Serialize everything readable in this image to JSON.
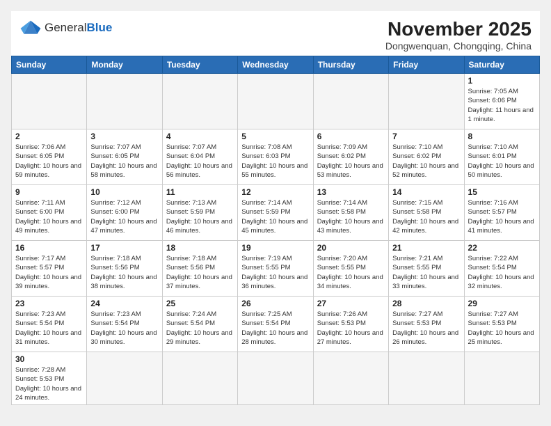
{
  "header": {
    "logo_general": "General",
    "logo_blue": "Blue",
    "month_title": "November 2025",
    "location": "Dongwenquan, Chongqing, China"
  },
  "weekdays": [
    "Sunday",
    "Monday",
    "Tuesday",
    "Wednesday",
    "Thursday",
    "Friday",
    "Saturday"
  ],
  "days": [
    {
      "num": "",
      "info": ""
    },
    {
      "num": "",
      "info": ""
    },
    {
      "num": "",
      "info": ""
    },
    {
      "num": "",
      "info": ""
    },
    {
      "num": "",
      "info": ""
    },
    {
      "num": "",
      "info": ""
    },
    {
      "num": "1",
      "info": "Sunrise: 7:05 AM\nSunset: 6:06 PM\nDaylight: 11 hours and 1 minute."
    },
    {
      "num": "2",
      "info": "Sunrise: 7:06 AM\nSunset: 6:05 PM\nDaylight: 10 hours and 59 minutes."
    },
    {
      "num": "3",
      "info": "Sunrise: 7:07 AM\nSunset: 6:05 PM\nDaylight: 10 hours and 58 minutes."
    },
    {
      "num": "4",
      "info": "Sunrise: 7:07 AM\nSunset: 6:04 PM\nDaylight: 10 hours and 56 minutes."
    },
    {
      "num": "5",
      "info": "Sunrise: 7:08 AM\nSunset: 6:03 PM\nDaylight: 10 hours and 55 minutes."
    },
    {
      "num": "6",
      "info": "Sunrise: 7:09 AM\nSunset: 6:02 PM\nDaylight: 10 hours and 53 minutes."
    },
    {
      "num": "7",
      "info": "Sunrise: 7:10 AM\nSunset: 6:02 PM\nDaylight: 10 hours and 52 minutes."
    },
    {
      "num": "8",
      "info": "Sunrise: 7:10 AM\nSunset: 6:01 PM\nDaylight: 10 hours and 50 minutes."
    },
    {
      "num": "9",
      "info": "Sunrise: 7:11 AM\nSunset: 6:00 PM\nDaylight: 10 hours and 49 minutes."
    },
    {
      "num": "10",
      "info": "Sunrise: 7:12 AM\nSunset: 6:00 PM\nDaylight: 10 hours and 47 minutes."
    },
    {
      "num": "11",
      "info": "Sunrise: 7:13 AM\nSunset: 5:59 PM\nDaylight: 10 hours and 46 minutes."
    },
    {
      "num": "12",
      "info": "Sunrise: 7:14 AM\nSunset: 5:59 PM\nDaylight: 10 hours and 45 minutes."
    },
    {
      "num": "13",
      "info": "Sunrise: 7:14 AM\nSunset: 5:58 PM\nDaylight: 10 hours and 43 minutes."
    },
    {
      "num": "14",
      "info": "Sunrise: 7:15 AM\nSunset: 5:58 PM\nDaylight: 10 hours and 42 minutes."
    },
    {
      "num": "15",
      "info": "Sunrise: 7:16 AM\nSunset: 5:57 PM\nDaylight: 10 hours and 41 minutes."
    },
    {
      "num": "16",
      "info": "Sunrise: 7:17 AM\nSunset: 5:57 PM\nDaylight: 10 hours and 39 minutes."
    },
    {
      "num": "17",
      "info": "Sunrise: 7:18 AM\nSunset: 5:56 PM\nDaylight: 10 hours and 38 minutes."
    },
    {
      "num": "18",
      "info": "Sunrise: 7:18 AM\nSunset: 5:56 PM\nDaylight: 10 hours and 37 minutes."
    },
    {
      "num": "19",
      "info": "Sunrise: 7:19 AM\nSunset: 5:55 PM\nDaylight: 10 hours and 36 minutes."
    },
    {
      "num": "20",
      "info": "Sunrise: 7:20 AM\nSunset: 5:55 PM\nDaylight: 10 hours and 34 minutes."
    },
    {
      "num": "21",
      "info": "Sunrise: 7:21 AM\nSunset: 5:55 PM\nDaylight: 10 hours and 33 minutes."
    },
    {
      "num": "22",
      "info": "Sunrise: 7:22 AM\nSunset: 5:54 PM\nDaylight: 10 hours and 32 minutes."
    },
    {
      "num": "23",
      "info": "Sunrise: 7:23 AM\nSunset: 5:54 PM\nDaylight: 10 hours and 31 minutes."
    },
    {
      "num": "24",
      "info": "Sunrise: 7:23 AM\nSunset: 5:54 PM\nDaylight: 10 hours and 30 minutes."
    },
    {
      "num": "25",
      "info": "Sunrise: 7:24 AM\nSunset: 5:54 PM\nDaylight: 10 hours and 29 minutes."
    },
    {
      "num": "26",
      "info": "Sunrise: 7:25 AM\nSunset: 5:54 PM\nDaylight: 10 hours and 28 minutes."
    },
    {
      "num": "27",
      "info": "Sunrise: 7:26 AM\nSunset: 5:53 PM\nDaylight: 10 hours and 27 minutes."
    },
    {
      "num": "28",
      "info": "Sunrise: 7:27 AM\nSunset: 5:53 PM\nDaylight: 10 hours and 26 minutes."
    },
    {
      "num": "29",
      "info": "Sunrise: 7:27 AM\nSunset: 5:53 PM\nDaylight: 10 hours and 25 minutes."
    },
    {
      "num": "30",
      "info": "Sunrise: 7:28 AM\nSunset: 5:53 PM\nDaylight: 10 hours and 24 minutes."
    },
    {
      "num": "",
      "info": ""
    },
    {
      "num": "",
      "info": ""
    },
    {
      "num": "",
      "info": ""
    },
    {
      "num": "",
      "info": ""
    },
    {
      "num": "",
      "info": ""
    },
    {
      "num": "",
      "info": ""
    }
  ]
}
